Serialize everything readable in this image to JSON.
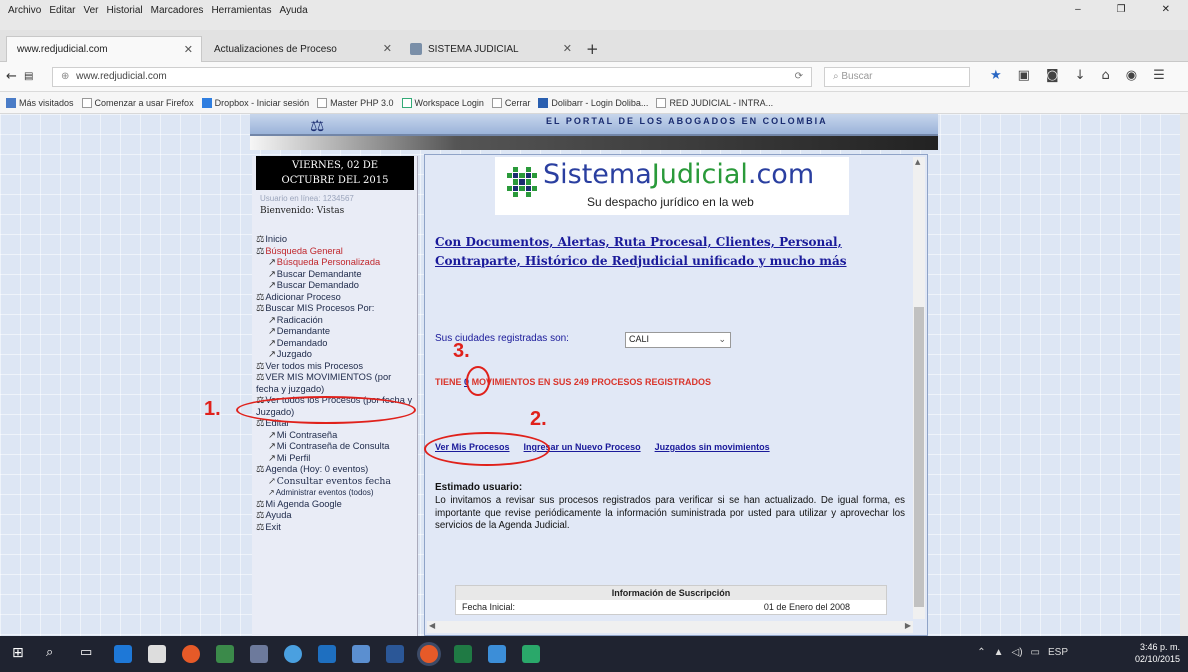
{
  "menubar": {
    "items": [
      "Archivo",
      "Editar",
      "Ver",
      "Historial",
      "Marcadores",
      "Herramientas",
      "Ayuda"
    ]
  },
  "tabs": [
    {
      "label": "www.redjudicial.com",
      "active": true
    },
    {
      "label": "Actualizaciones de Proceso",
      "active": false
    },
    {
      "label": "SISTEMA JUDICIAL",
      "active": false
    }
  ],
  "nav": {
    "url": "www.redjudicial.com",
    "search_placeholder": "Buscar"
  },
  "bookmarks": [
    "Más visitados",
    "Comenzar a usar Firefox",
    "Dropbox - Iniciar sesión",
    "Master PHP 3.0",
    "Workspace Login",
    "Cerrar",
    "Dolibarr - Login Doliba...",
    "RED JUDICIAL - INTRA..."
  ],
  "banner": {
    "tagline": "EL PORTAL DE LOS ABOGADOS EN COLOMBIA"
  },
  "sidebar": {
    "date_line1": "VIERNES, 02 DE",
    "date_line2": "OCTUBRE DEL 2015",
    "user_hint": "Usuario en línea: 1234567",
    "welcome": "Bienvenido: Vistas",
    "menu": [
      {
        "label": "Inicio",
        "level": 0
      },
      {
        "label": "Búsqueda General",
        "level": 0,
        "red": true
      },
      {
        "label": "Búsqueda Personalizada",
        "level": 1,
        "red": true
      },
      {
        "label": "Buscar Demandante",
        "level": 1
      },
      {
        "label": "Buscar Demandado",
        "level": 1
      },
      {
        "label": "Adicionar Proceso",
        "level": 0
      },
      {
        "label": "Buscar MIS Procesos Por:",
        "level": 0
      },
      {
        "label": "Radicación",
        "level": 1
      },
      {
        "label": "Demandante",
        "level": 1
      },
      {
        "label": "Demandado",
        "level": 1
      },
      {
        "label": "Juzgado",
        "level": 1
      },
      {
        "label": "Ver todos mis Procesos",
        "level": 0
      },
      {
        "label": "VER MIS MOVIMIENTOS (por fecha y juzgado)",
        "level": 0
      },
      {
        "label": "Ver todos los Procesos (por fecha y Juzgado)",
        "level": 0
      },
      {
        "label": "Editar",
        "level": 0
      },
      {
        "label": "Mi Contraseña",
        "level": 1
      },
      {
        "label": "Mi Contraseña de Consulta",
        "level": 1
      },
      {
        "label": "Mi Perfil",
        "level": 1
      },
      {
        "label": "Agenda (Hoy: 0 eventos)",
        "level": 0
      },
      {
        "label": "Consultar eventos fecha",
        "level": 1
      },
      {
        "label": "Administrar eventos (todos)",
        "level": 1
      },
      {
        "label": "Mi Agenda Google",
        "level": 0
      },
      {
        "label": "Ayuda",
        "level": 0
      },
      {
        "label": "Exit",
        "level": 0
      }
    ]
  },
  "main": {
    "logo_text_1": "Sistema",
    "logo_text_2": "Judicial",
    "logo_text_3": ".com",
    "logo_sub": "Su despacho jurídico en la web",
    "promo": "Con Documentos, Alertas, Ruta Procesal, Clientes, Personal, Contraparte, Histórico de Redjudicial unificado y mucho más",
    "cities_label": "Sus ciudades registradas son:",
    "city_selected": "CALI",
    "moves_prefix": "TIENE",
    "moves_count": "0",
    "moves_suffix": "MOVIMIENTOS EN SUS 249 PROCESOS REGISTRADOS",
    "link_ver": "Ver Mis Procesos",
    "link_ingresar": "Ingresar un Nuevo Proceso",
    "link_juzgados": "Juzgados sin movimientos",
    "estimado": "Estimado usuario:",
    "body": "Lo invitamos a revisar sus procesos registrados para verificar si se han actualizado. De igual forma, es importante que revise periódicamente la información suministrada por usted para utilizar y aprovechar los servicios de la Agenda Judicial.",
    "subs_title": "Información de Suscripción",
    "subs_label": "Fecha Inicial:",
    "subs_value": "01 de Enero del 2008"
  },
  "annotations": {
    "a1": "1.",
    "a2": "2.",
    "a3": "3."
  },
  "taskbar": {
    "lang": "ESP",
    "time": "3:46 p. m.",
    "date": "02/10/2015"
  },
  "colors": {
    "annotation": "#e0211b",
    "link": "#1a1a9a",
    "alert": "#d9342b"
  }
}
